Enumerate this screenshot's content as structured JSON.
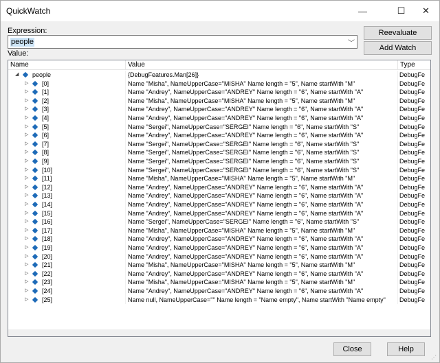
{
  "window": {
    "title": "QuickWatch",
    "minimize_glyph": "—",
    "maximize_glyph": "☐",
    "close_glyph": "✕"
  },
  "expression": {
    "label": "Expression:",
    "value": "people"
  },
  "buttons": {
    "reevaluate": "Reevaluate",
    "add_watch": "Add Watch",
    "close": "Close",
    "help": "Help"
  },
  "value_label": "Value:",
  "grid": {
    "columns": [
      "Name",
      "Value",
      "Type"
    ],
    "root": {
      "name": "people",
      "value": "{DebugFeatures.Man[26]}",
      "type": "DebugFe"
    },
    "rows": [
      {
        "name": "[0]",
        "value": "Name \"Misha\", NameUpperCase=\"MISHA\" Name length = \"5\", Name startWith \"M\"",
        "type": "DebugFe"
      },
      {
        "name": "[1]",
        "value": "Name \"Andrey\", NameUpperCase=\"ANDREY\" Name length = \"6\", Name startWith \"A\"",
        "type": "DebugFe"
      },
      {
        "name": "[2]",
        "value": "Name \"Misha\", NameUpperCase=\"MISHA\" Name length = \"5\", Name startWith \"M\"",
        "type": "DebugFe"
      },
      {
        "name": "[3]",
        "value": "Name \"Andrey\", NameUpperCase=\"ANDREY\" Name length = \"6\", Name startWith \"A\"",
        "type": "DebugFe"
      },
      {
        "name": "[4]",
        "value": "Name \"Andrey\", NameUpperCase=\"ANDREY\" Name length = \"6\", Name startWith \"A\"",
        "type": "DebugFe"
      },
      {
        "name": "[5]",
        "value": "Name \"Sergei\", NameUpperCase=\"SERGEI\" Name length = \"6\", Name startWith \"S\"",
        "type": "DebugFe"
      },
      {
        "name": "[6]",
        "value": "Name \"Andrey\", NameUpperCase=\"ANDREY\" Name length = \"6\", Name startWith \"A\"",
        "type": "DebugFe"
      },
      {
        "name": "[7]",
        "value": "Name \"Sergei\", NameUpperCase=\"SERGEI\" Name length = \"6\", Name startWith \"S\"",
        "type": "DebugFe"
      },
      {
        "name": "[8]",
        "value": "Name \"Sergei\", NameUpperCase=\"SERGEI\" Name length = \"6\", Name startWith \"S\"",
        "type": "DebugFe"
      },
      {
        "name": "[9]",
        "value": "Name \"Sergei\", NameUpperCase=\"SERGEI\" Name length = \"6\", Name startWith \"S\"",
        "type": "DebugFe"
      },
      {
        "name": "[10]",
        "value": "Name \"Sergei\", NameUpperCase=\"SERGEI\" Name length = \"6\", Name startWith \"S\"",
        "type": "DebugFe"
      },
      {
        "name": "[11]",
        "value": "Name \"Misha\", NameUpperCase=\"MISHA\" Name length = \"5\", Name startWith \"M\"",
        "type": "DebugFe"
      },
      {
        "name": "[12]",
        "value": "Name \"Andrey\", NameUpperCase=\"ANDREY\" Name length = \"6\", Name startWith \"A\"",
        "type": "DebugFe"
      },
      {
        "name": "[13]",
        "value": "Name \"Andrey\", NameUpperCase=\"ANDREY\" Name length = \"6\", Name startWith \"A\"",
        "type": "DebugFe"
      },
      {
        "name": "[14]",
        "value": "Name \"Andrey\", NameUpperCase=\"ANDREY\" Name length = \"6\", Name startWith \"A\"",
        "type": "DebugFe"
      },
      {
        "name": "[15]",
        "value": "Name \"Andrey\", NameUpperCase=\"ANDREY\" Name length = \"6\", Name startWith \"A\"",
        "type": "DebugFe"
      },
      {
        "name": "[16]",
        "value": "Name \"Sergei\", NameUpperCase=\"SERGEI\" Name length = \"6\", Name startWith \"S\"",
        "type": "DebugFe"
      },
      {
        "name": "[17]",
        "value": "Name \"Misha\", NameUpperCase=\"MISHA\" Name length = \"5\", Name startWith \"M\"",
        "type": "DebugFe"
      },
      {
        "name": "[18]",
        "value": "Name \"Andrey\", NameUpperCase=\"ANDREY\" Name length = \"6\", Name startWith \"A\"",
        "type": "DebugFe"
      },
      {
        "name": "[19]",
        "value": "Name \"Andrey\", NameUpperCase=\"ANDREY\" Name length = \"6\", Name startWith \"A\"",
        "type": "DebugFe"
      },
      {
        "name": "[20]",
        "value": "Name \"Andrey\", NameUpperCase=\"ANDREY\" Name length = \"6\", Name startWith \"A\"",
        "type": "DebugFe"
      },
      {
        "name": "[21]",
        "value": "Name \"Misha\", NameUpperCase=\"MISHA\" Name length = \"5\", Name startWith \"M\"",
        "type": "DebugFe"
      },
      {
        "name": "[22]",
        "value": "Name \"Andrey\", NameUpperCase=\"ANDREY\" Name length = \"6\", Name startWith \"A\"",
        "type": "DebugFe"
      },
      {
        "name": "[23]",
        "value": "Name \"Misha\", NameUpperCase=\"MISHA\" Name length = \"5\", Name startWith \"M\"",
        "type": "DebugFe"
      },
      {
        "name": "[24]",
        "value": "Name \"Andrey\", NameUpperCase=\"ANDREY\" Name length = \"6\", Name startWith \"A\"",
        "type": "DebugFe"
      },
      {
        "name": "[25]",
        "value": "Name null, NameUpperCase=\"\" Name length = \"Name empty\", Name startWith \"Name empty\"",
        "type": "DebugFe"
      }
    ]
  },
  "colors": {
    "icon": "#1e6bb8",
    "selection": "#cce4f7"
  },
  "icons": {
    "expand_arrow": "▷",
    "collapse_arrow": "◢",
    "dropdown_arrow": "﹀"
  }
}
